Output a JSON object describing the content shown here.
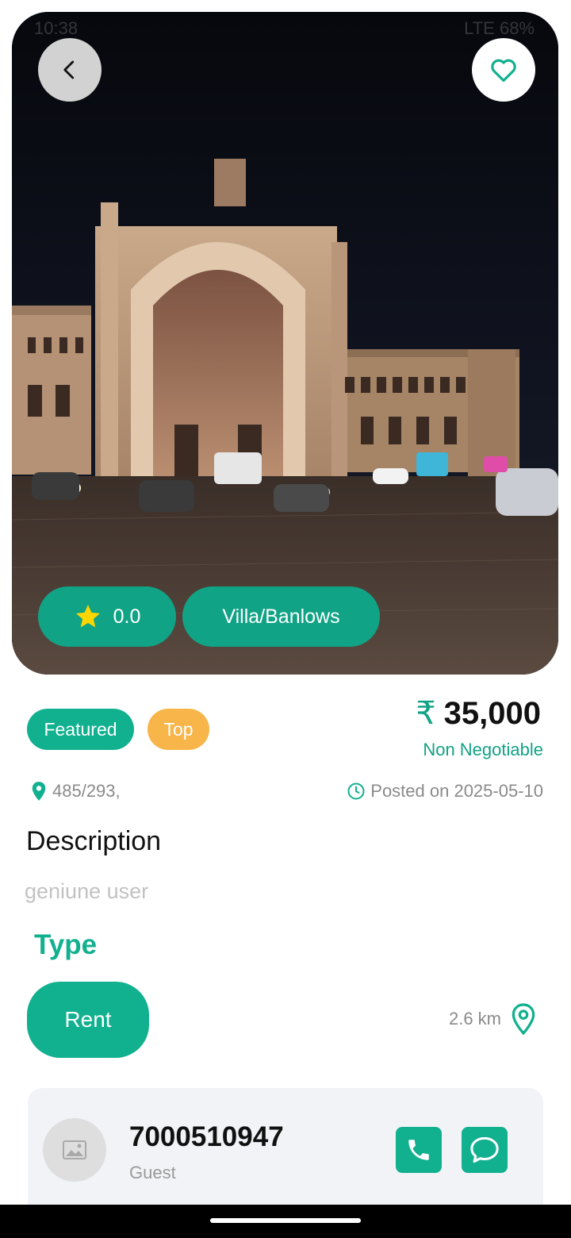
{
  "status_bar": {
    "time": "10:38",
    "network": "LTE",
    "battery": "68%"
  },
  "hero": {
    "back_icon": "chevron-left-icon",
    "favorite_icon": "heart-outline-icon",
    "rating": "0.0",
    "property_type": "Villa/Banlows"
  },
  "listing": {
    "badges": {
      "featured": "Featured",
      "top": "Top"
    },
    "currency_symbol": "₹",
    "price": "35,000",
    "negotiable": "Non Negotiable",
    "address": "485/293,",
    "posted": "Posted on 2025-05-10",
    "description_title": "Description",
    "description": "geniune user",
    "type_title": "Type",
    "type_value": "Rent",
    "distance": "2.6 km"
  },
  "owner": {
    "phone": "7000510947",
    "role": "Guest"
  },
  "colors": {
    "accent": "#11b08e",
    "accent_dark": "#11a385",
    "top_badge": "#f8b54a",
    "star": "#ffd600"
  }
}
